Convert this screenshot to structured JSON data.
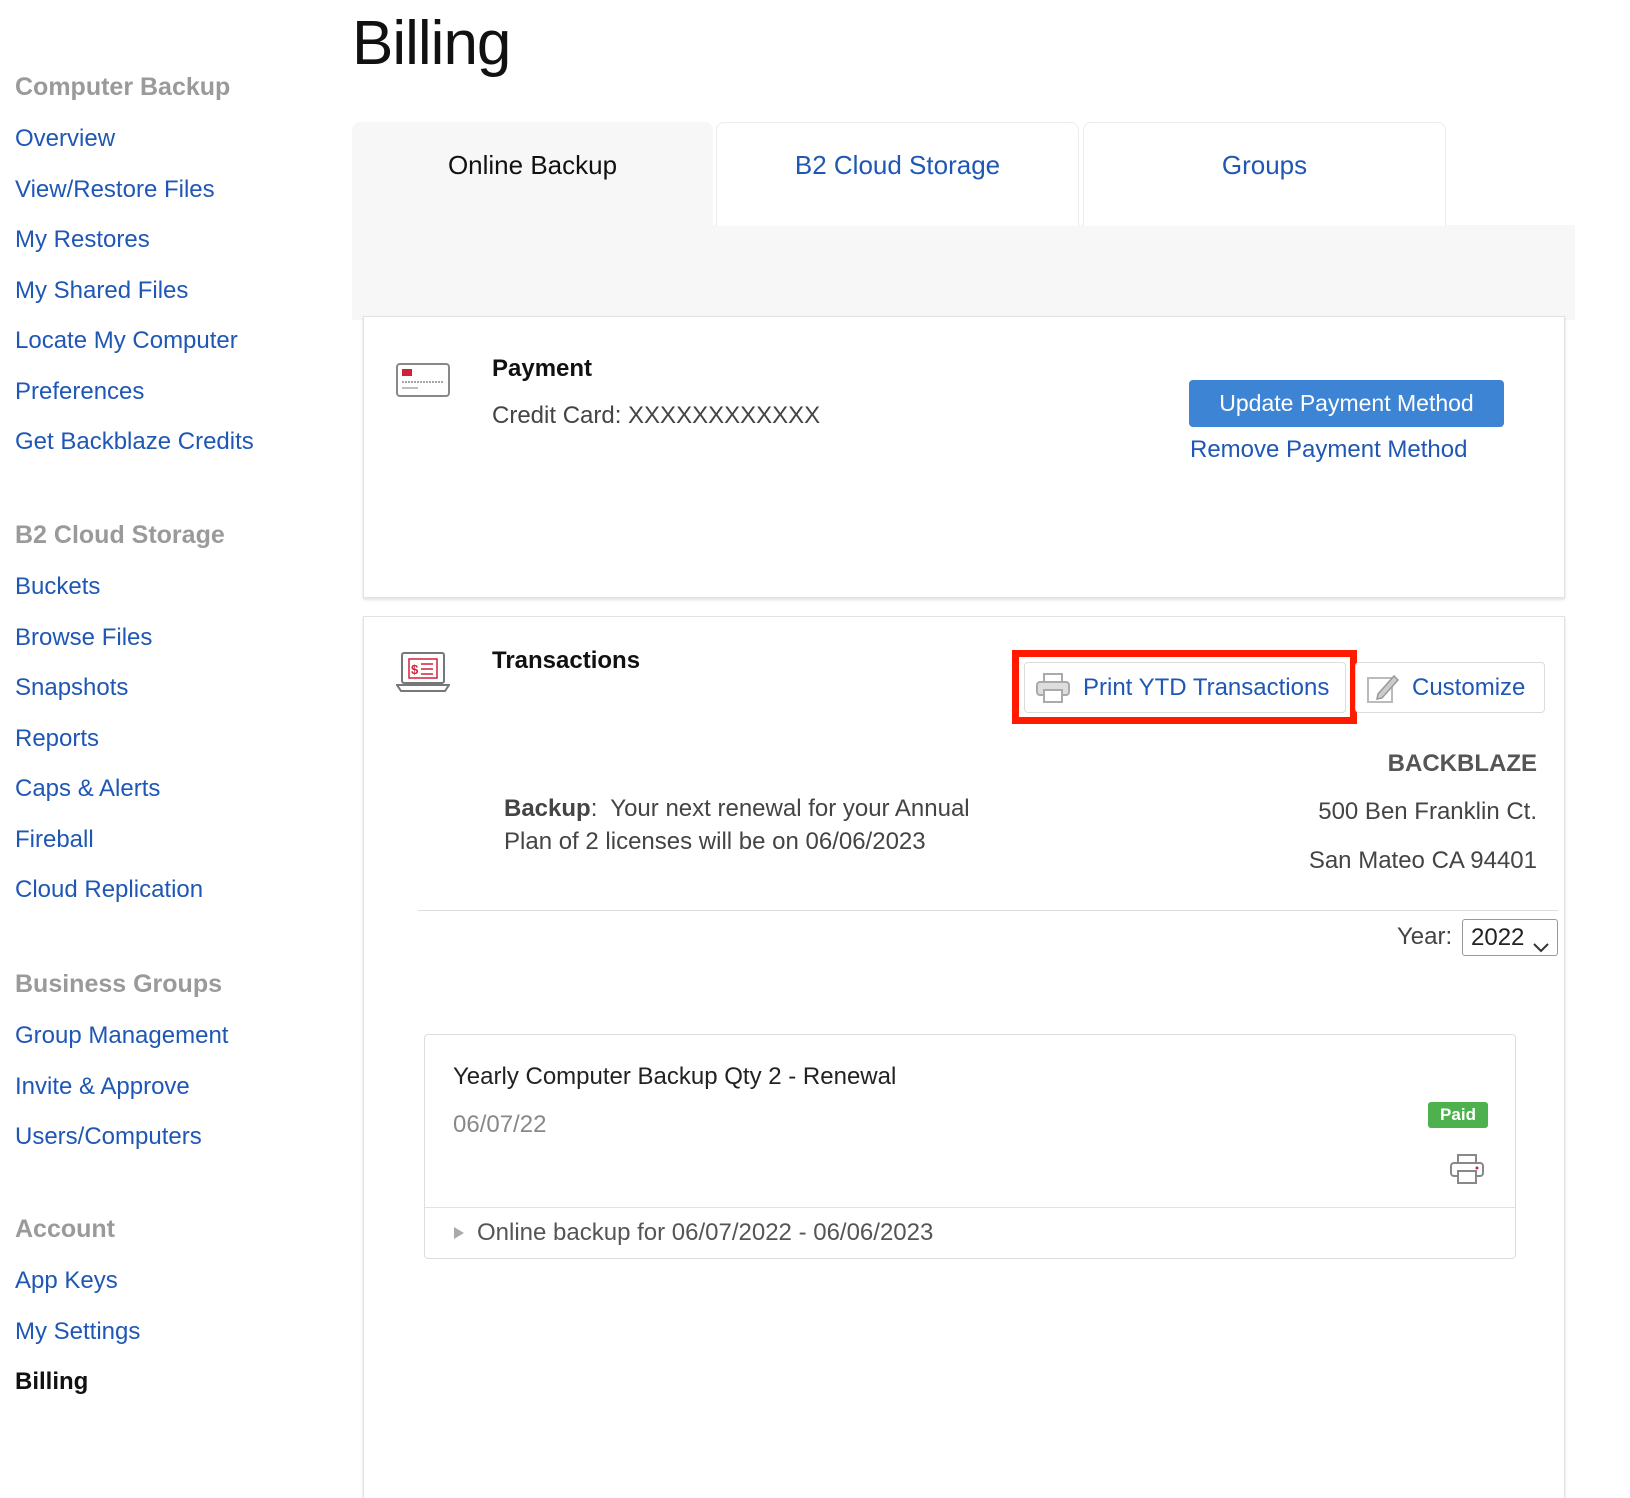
{
  "page_title": "Billing",
  "sidebar": {
    "sections": [
      {
        "heading": "Computer Backup",
        "items": [
          "Overview",
          "View/Restore Files",
          "My Restores",
          "My Shared Files",
          "Locate My Computer",
          "Preferences",
          "Get Backblaze Credits"
        ]
      },
      {
        "heading": "B2 Cloud Storage",
        "items": [
          "Buckets",
          "Browse Files",
          "Snapshots",
          "Reports",
          "Caps & Alerts",
          "Fireball",
          "Cloud Replication"
        ]
      },
      {
        "heading": "Business Groups",
        "items": [
          "Group Management",
          "Invite & Approve",
          "Users/Computers"
        ]
      },
      {
        "heading": "Account",
        "items": [
          "App Keys",
          "My Settings",
          "Billing"
        ]
      }
    ],
    "active_item": "Billing"
  },
  "tabs": [
    "Online Backup",
    "B2 Cloud Storage",
    "Groups"
  ],
  "active_tab": "Online Backup",
  "payment": {
    "title": "Payment",
    "card_label": "Credit Card: XXXXXXXXXXXX",
    "update_button": "Update Payment Method",
    "remove_link": "Remove Payment Method",
    "icon": "credit-card-icon"
  },
  "transactions": {
    "title": "Transactions",
    "icon": "invoice-laptop-icon",
    "print_button": "Print YTD Transactions",
    "customize_button": "Customize",
    "renewal_label": "Backup",
    "renewal_separator": ":",
    "renewal_line1": "Your next renewal for your Annual",
    "renewal_line2": "Plan of 2 licenses will be on 06/06/2023",
    "company": {
      "name": "BACKBLAZE",
      "street": "500 Ben Franklin Ct.",
      "city": "San Mateo CA 94401"
    },
    "year_label": "Year:",
    "year_value": "2022",
    "items": [
      {
        "title": "Yearly Computer Backup Qty 2 - Renewal",
        "date": "06/07/22",
        "status": "Paid",
        "detail": "Online backup for 06/07/2022 - 06/06/2023"
      }
    ]
  },
  "colors": {
    "link": "#1f57b5",
    "primary_button": "#3d85d4",
    "paid_badge": "#4db24d",
    "highlight": "#ff1a00"
  }
}
